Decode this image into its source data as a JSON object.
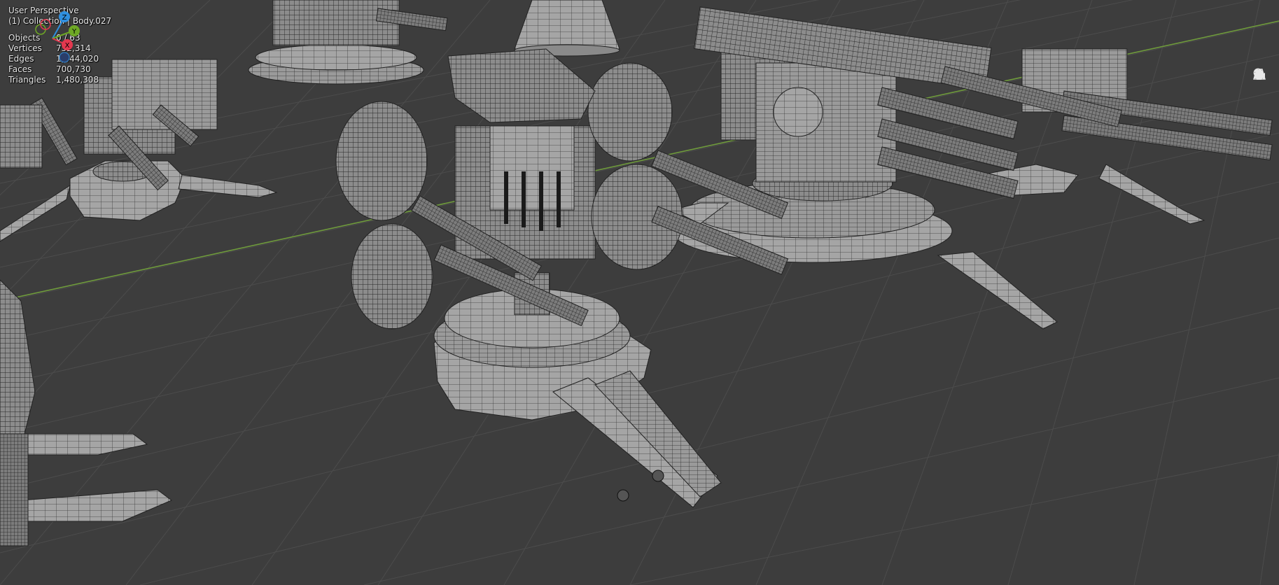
{
  "header": {
    "perspective": "User Perspective",
    "collection": "(1) Collection | Body.027"
  },
  "stats": [
    {
      "label": "Objects",
      "value": "0 / 63"
    },
    {
      "label": "Vertices",
      "value": "752,314"
    },
    {
      "label": "Edges",
      "value": "1,444,020"
    },
    {
      "label": "Faces",
      "value": "700,730"
    },
    {
      "label": "Triangles",
      "value": "1,480,308"
    }
  ],
  "gizmo": {
    "z_label": "Z",
    "y_label": "Y",
    "x_label": "X",
    "colors": {
      "x": "#e4384f",
      "y": "#6ea825",
      "z": "#2f8fdf"
    }
  },
  "tools": [
    "zoom-icon",
    "hand-pan-icon",
    "camera-view-icon",
    "grid-ortho-icon"
  ],
  "colors": {
    "background": "#3d3d3d",
    "grid": "#4a4a4a",
    "x_axis_line": "#6f9b3c",
    "mesh_fill": "#8e8e8e",
    "wire": "#2e2e2e"
  }
}
